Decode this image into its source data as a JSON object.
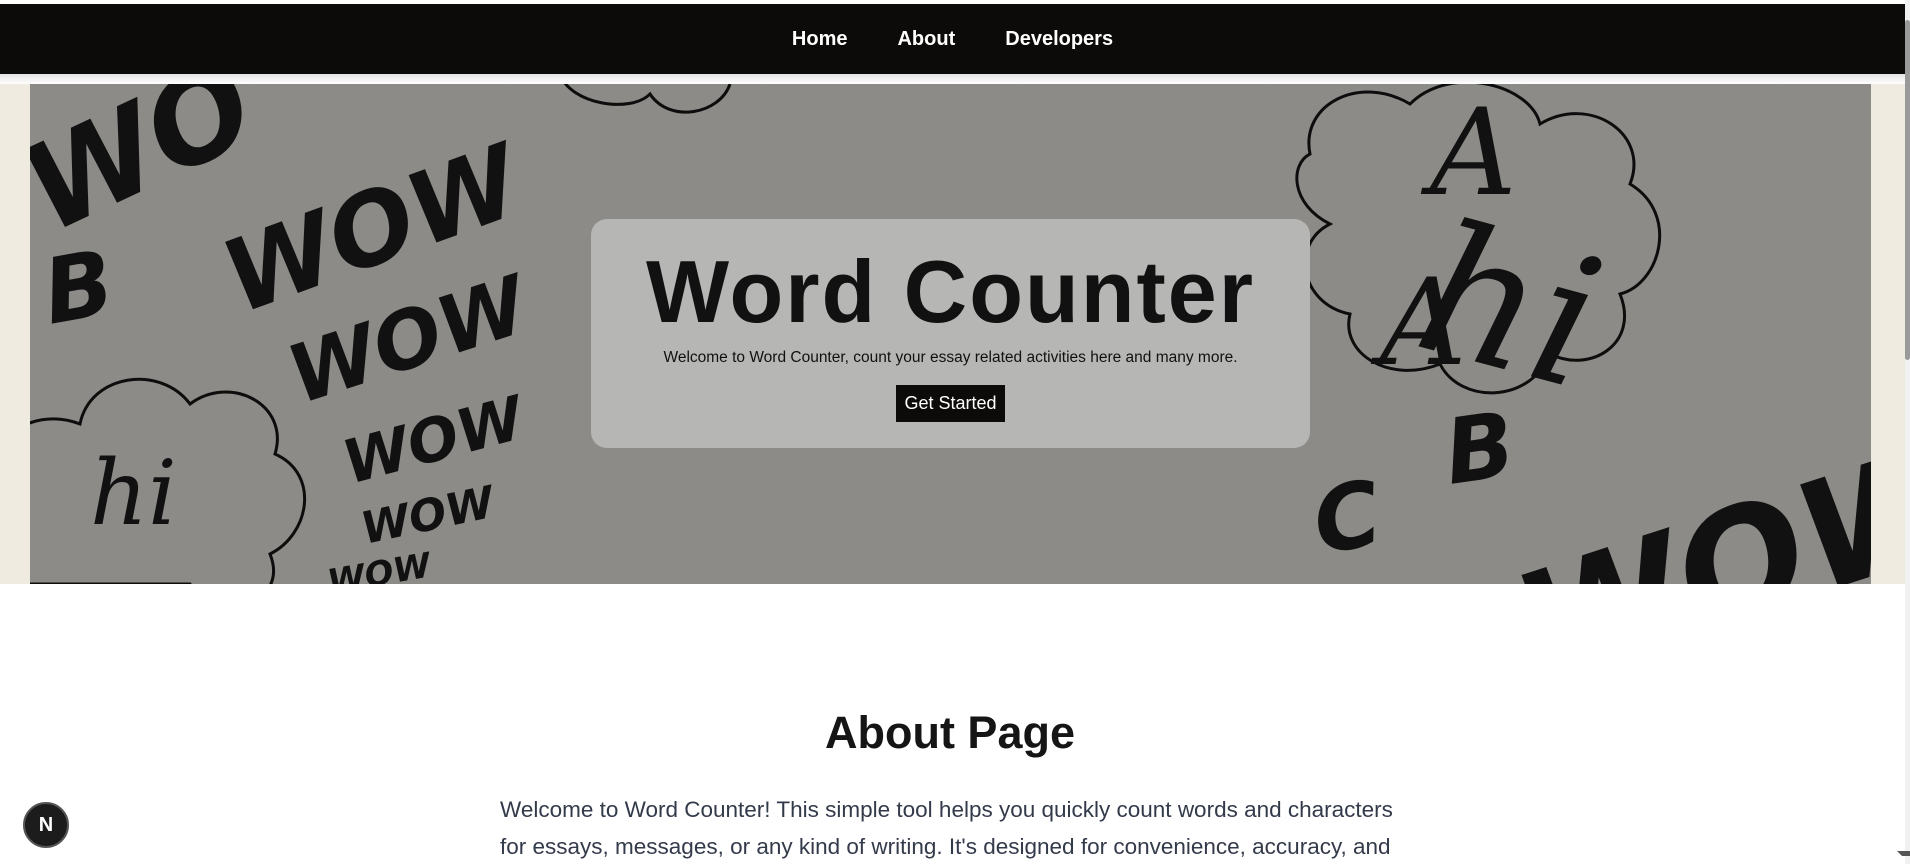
{
  "nav": {
    "items": [
      {
        "label": "Home"
      },
      {
        "label": "About"
      },
      {
        "label": "Developers"
      }
    ]
  },
  "hero": {
    "title": "Word Counter",
    "subtitle": "Welcome to Word Counter, count your essay related activities here and many more.",
    "button_label": "Get Started",
    "doodles": [
      "WOW",
      "hi",
      "B",
      "C"
    ]
  },
  "about": {
    "title": "About Page",
    "text": "Welcome to Word Counter! This simple tool helps you quickly count words and characters for essays, messages, or any kind of writing. It's designed for convenience, accuracy, and"
  },
  "dev_badge": {
    "letter": "N"
  },
  "colors": {
    "nav_bg": "#0c0b09",
    "hero_bg": "#8c8b87",
    "hero_card": "#b6b6b4"
  }
}
